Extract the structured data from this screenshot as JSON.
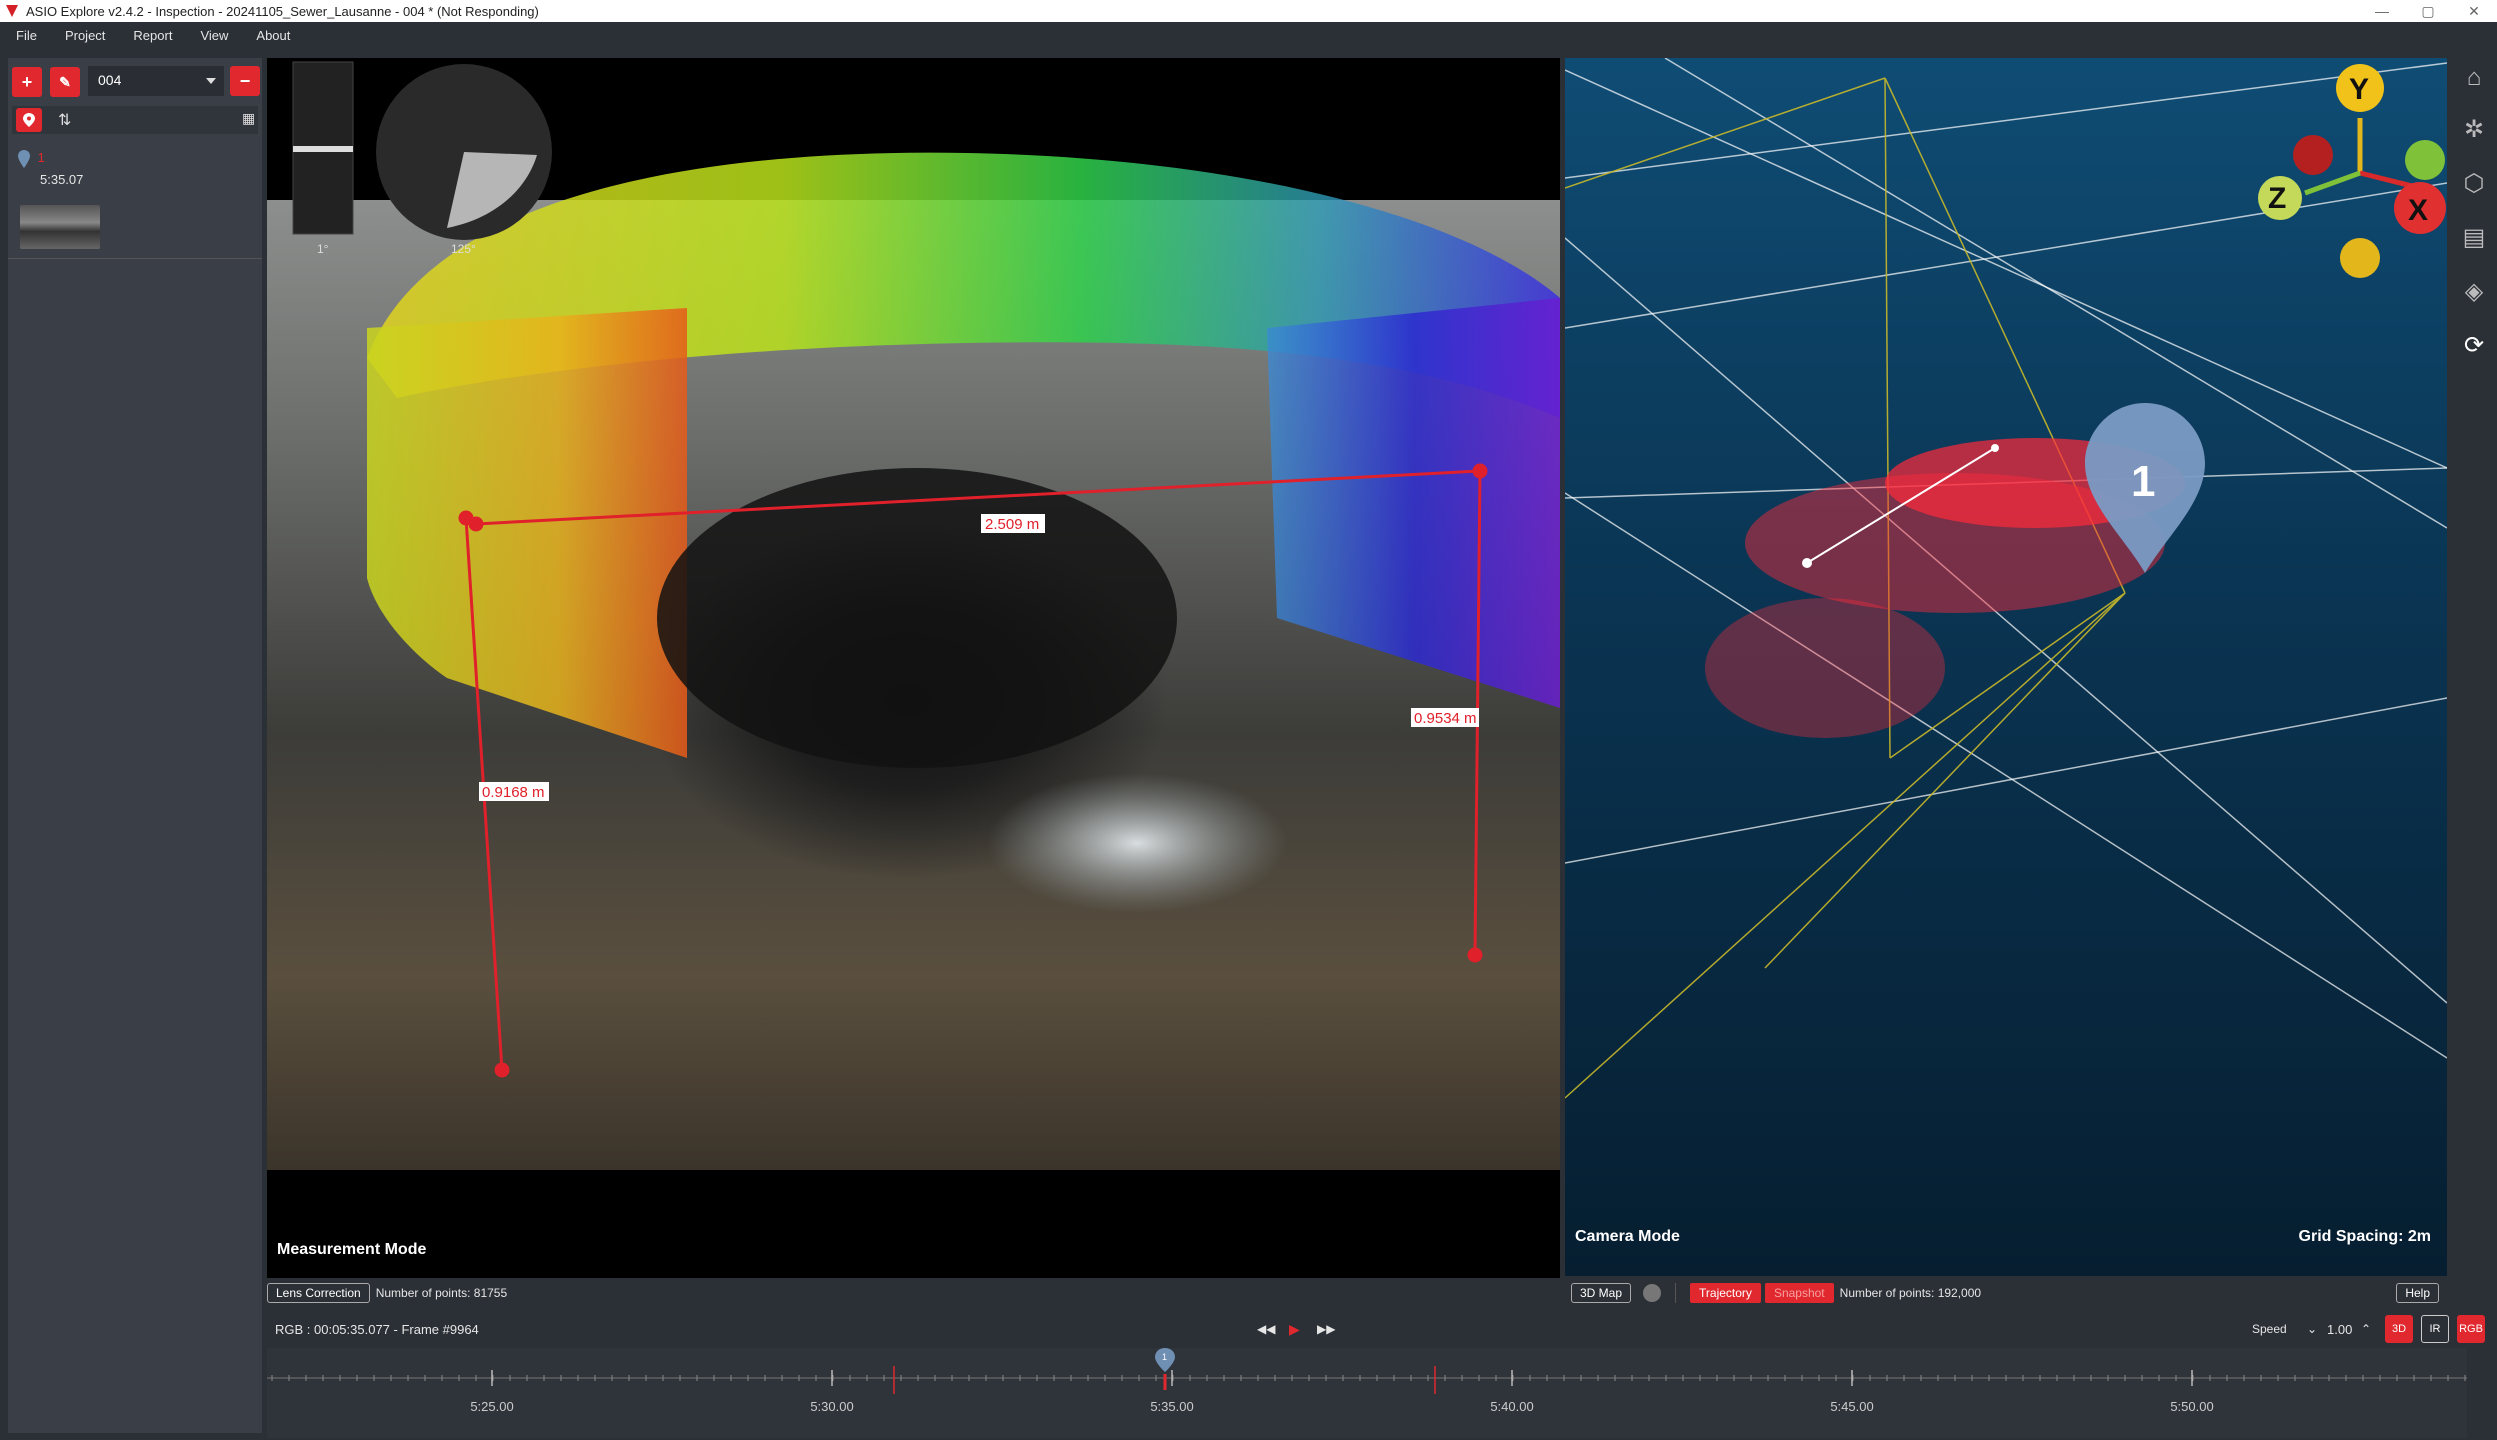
{
  "window": {
    "title": "ASIO Explore v2.4.2 - Inspection - 20241105_Sewer_Lausanne - 004 * (Not Responding)",
    "controls": [
      "—",
      "▢",
      "✕"
    ]
  },
  "menu": [
    "File",
    "Project",
    "Report",
    "View",
    "About"
  ],
  "leftpanel": {
    "add_label": "+",
    "edit_label": "✎",
    "remove_label": "−",
    "selected_inspection": "004",
    "marker": {
      "number": "1",
      "time": "5:35.07"
    }
  },
  "left_view": {
    "gauge1_label": "1°",
    "gauge2_label": "125°",
    "measurements": [
      "2.509 m",
      "0.9534 m",
      "0.9168 m"
    ],
    "mode_label": "Measurement Mode"
  },
  "left_status": {
    "lens_button": "Lens Correction",
    "points": "Number of points: 81755"
  },
  "right_view": {
    "axis_y": "Y",
    "axis_x": "X",
    "axis_z": "Z",
    "marker_number": "1",
    "mode_label": "Camera Mode",
    "grid_label": "Grid Spacing: 2m"
  },
  "right_status": {
    "map_button": "3D Map",
    "trajectory_button": "Trajectory",
    "snapshot_button": "Snapshot",
    "points": "Number of points: 192,000",
    "help_button": "Help"
  },
  "timeline": {
    "frame_info": "RGB : 00:05:35.077 - Frame #9964",
    "speed_label": "Speed",
    "speed_value": "1.00",
    "mode_3d": "3D",
    "mode_ir": "IR",
    "mode_rgb": "RGB",
    "marker_number": "1",
    "ticks": [
      "5:25.00",
      "5:30.00",
      "5:35.00",
      "5:40.00",
      "5:45.00",
      "5:50.00"
    ]
  },
  "colors": {
    "accent": "#e0282e",
    "panel": "#3a3f47",
    "background": "#2b2f36"
  }
}
